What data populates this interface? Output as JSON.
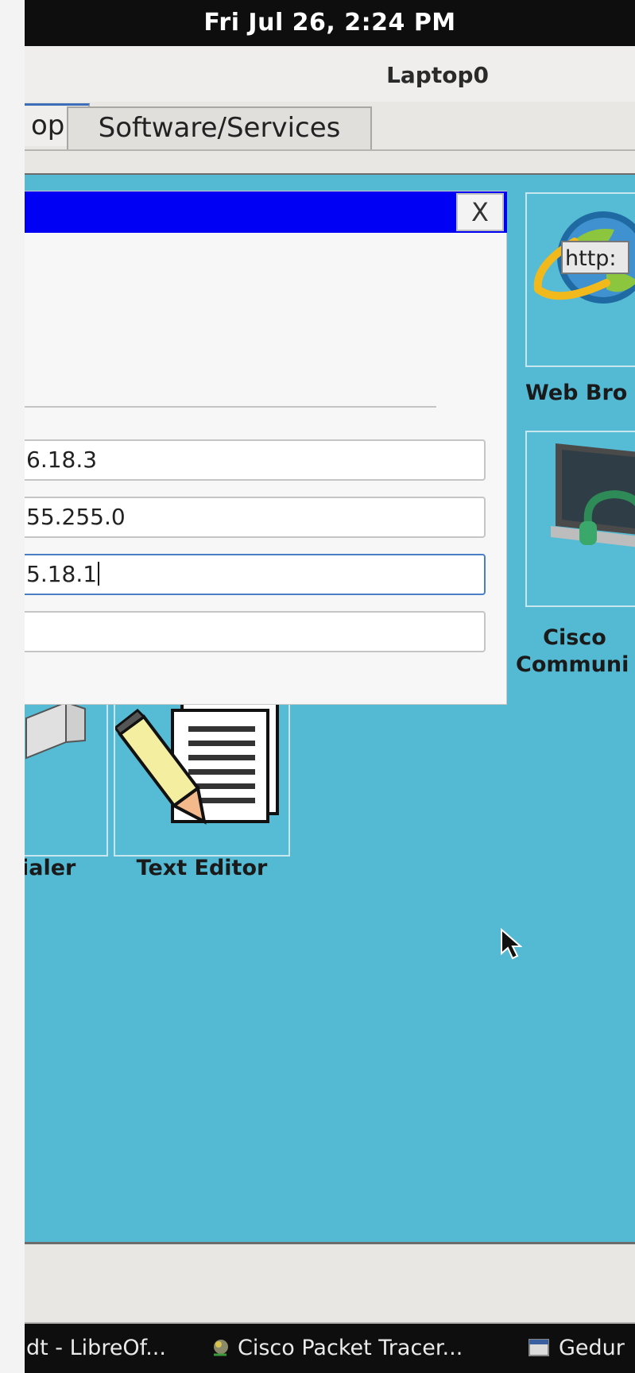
{
  "topbar": {
    "clock": "Fri Jul 26,  2:24 PM"
  },
  "window": {
    "title": "Laptop0"
  },
  "tabs": [
    {
      "label": "op",
      "selected": true
    },
    {
      "label": "Software/Services",
      "selected": false
    }
  ],
  "desktop": {
    "background_color": "#54b9d3",
    "apps": [
      {
        "label": "Web Bro",
        "icon": "web-browser-icon",
        "icon_text": "http:"
      },
      {
        "label_line1": "Cisco",
        "label_line2": "Communi",
        "icon": "cisco-communicator-icon"
      },
      {
        "label": "ialer",
        "icon": "pppoe-dialer-icon"
      },
      {
        "label": "Text Editor",
        "icon": "text-editor-icon"
      }
    ]
  },
  "dialog": {
    "titlebar_color": "#0000f4",
    "close_label": "X",
    "fields": {
      "ip_address": "6.18.3",
      "subnet_mask": "55.255.0",
      "default_gateway": "5.18.1",
      "dns_server": ""
    }
  },
  "taskbar": {
    "items": [
      {
        "label": "dt - LibreOf..."
      },
      {
        "label": "Cisco Packet Tracer..."
      },
      {
        "label": "Gedur"
      }
    ]
  }
}
